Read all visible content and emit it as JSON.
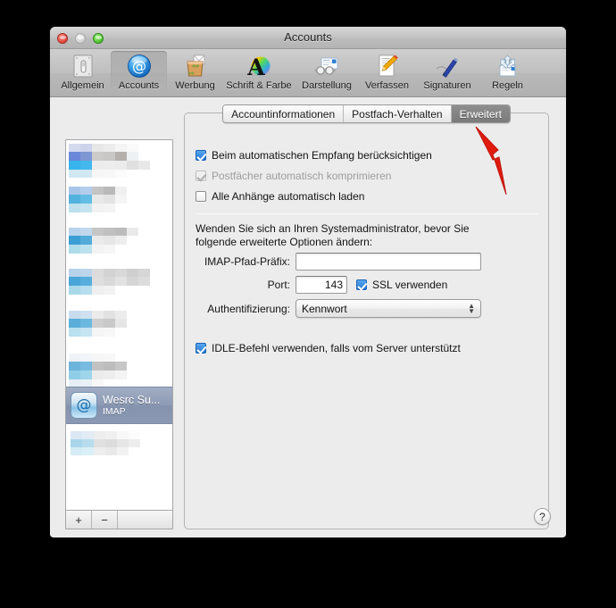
{
  "window": {
    "title": "Accounts",
    "controls": {
      "close": "close-button",
      "minimize": "minimize-button",
      "zoom": "zoom-button"
    }
  },
  "toolbar": {
    "items": [
      {
        "label": "Allgemein",
        "icon": "general-switch-icon",
        "selected": false
      },
      {
        "label": "Accounts",
        "icon": "at-sign-icon",
        "selected": true
      },
      {
        "label": "Werbung",
        "icon": "junk-bag-icon",
        "selected": false
      },
      {
        "label": "Schrift & Farbe",
        "icon": "font-color-icon",
        "selected": false
      },
      {
        "label": "Darstellung",
        "icon": "viewing-glasses-icon",
        "selected": false
      },
      {
        "label": "Verfassen",
        "icon": "compose-pencil-icon",
        "selected": false
      },
      {
        "label": "Signaturen",
        "icon": "signature-pen-icon",
        "selected": false
      },
      {
        "label": "Regeln",
        "icon": "rules-arrows-icon",
        "selected": false
      }
    ]
  },
  "sidebar": {
    "selected_account": {
      "name": "Wesrc Su...",
      "type": "IMAP",
      "icon": "at-sign-account-icon"
    },
    "add_label": "+",
    "remove_label": "−"
  },
  "tabs": [
    {
      "label": "Accountinformationen",
      "active": false
    },
    {
      "label": "Postfach-Verhalten",
      "active": false
    },
    {
      "label": "Erweitert",
      "active": true
    }
  ],
  "options": {
    "include_auto_fetch": {
      "label": "Beim automatischen Empfang berücksichtigen",
      "checked": true,
      "disabled": false
    },
    "compact_mailboxes": {
      "label": "Postfächer automatisch komprimieren",
      "checked": true,
      "disabled": true
    },
    "download_attachments": {
      "label": "Alle Anhänge automatisch laden",
      "checked": false,
      "disabled": false
    }
  },
  "advanced": {
    "note": "Wenden Sie sich an Ihren Systemadministrator, bevor Sie folgende erweiterte Optionen ändern:",
    "imap_prefix": {
      "label": "IMAP-Pfad-Präfix:",
      "value": "",
      "placeholder": ""
    },
    "port": {
      "label": "Port:",
      "value": "143"
    },
    "ssl": {
      "label": "SSL verwenden",
      "checked": true
    },
    "authentication": {
      "label": "Authentifizierung:",
      "value": "Kennwort"
    },
    "idle": {
      "label": "IDLE-Befehl verwenden, falls vom Server unterstützt",
      "checked": true
    }
  },
  "help": {
    "label": "?"
  },
  "annotation": {
    "type": "red-arrow",
    "points_at": "Erweitert",
    "color": "#e01b0e"
  },
  "colors": {
    "accent": "#2076d4",
    "selection": "#8c9ab4",
    "window_bg": "#ececec",
    "desktop_bg": "#000000",
    "annotation_red": "#e01b0e"
  }
}
